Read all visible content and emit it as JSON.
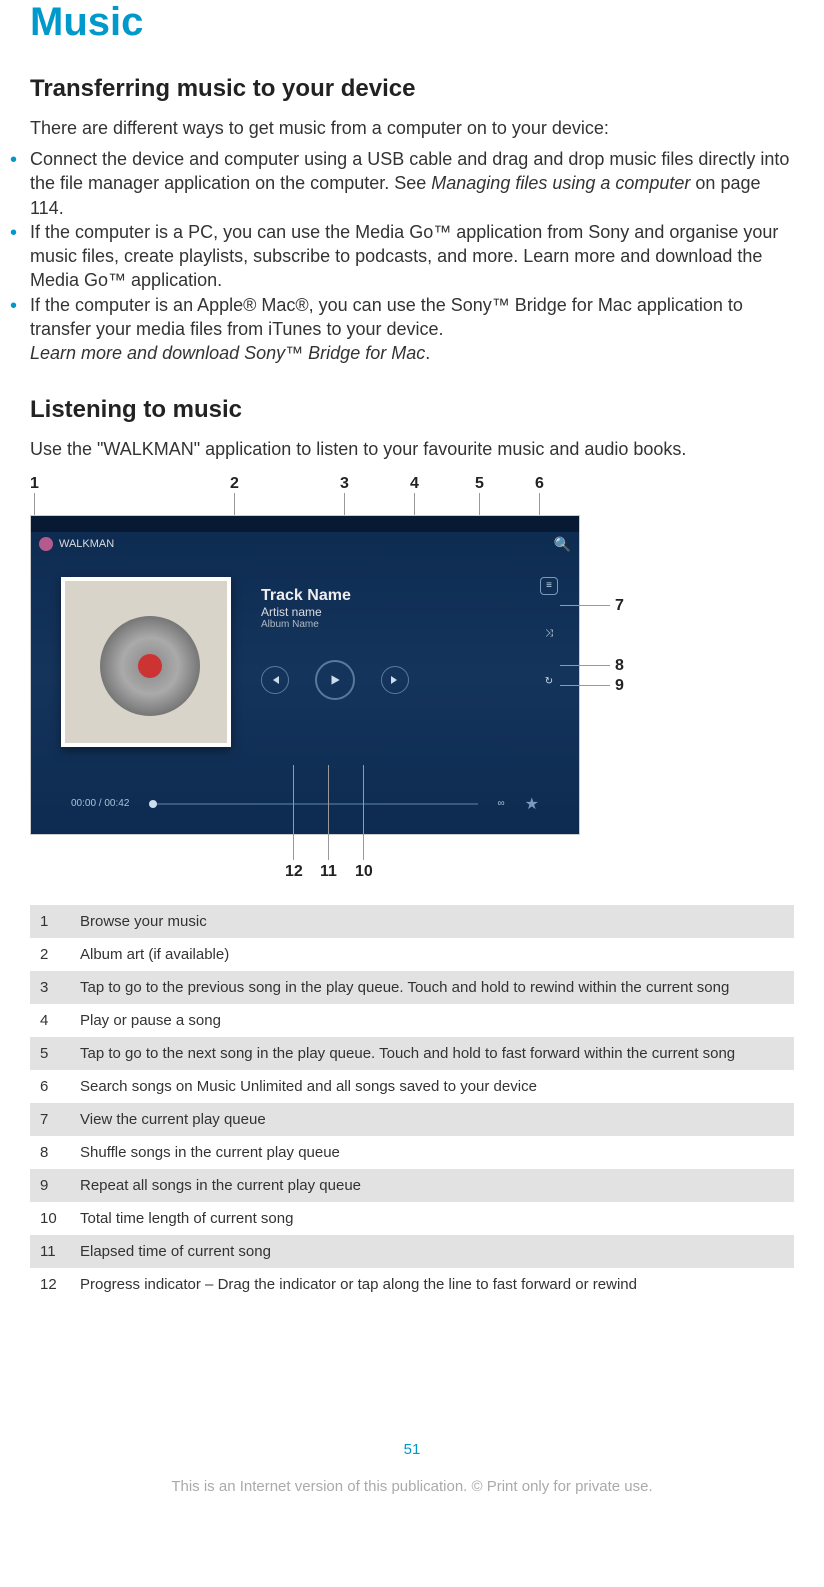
{
  "title": "Music",
  "section1": {
    "heading": "Transferring music to your device",
    "intro": "There are different ways to get music from a computer on to your device:",
    "bullets": [
      {
        "text_a": "Connect the device and computer using a USB cable and drag and drop music files directly into the file manager application on the computer. See ",
        "italic": "Managing files using a computer",
        "text_b": " on page 114."
      },
      {
        "text_a": "If the computer is a PC, you can use the Media Go™ application from Sony and organise your music files, create playlists, subscribe to podcasts, and more. Learn more and download the Media Go™ application.",
        "italic": "",
        "text_b": ""
      },
      {
        "text_a": "If the computer is an Apple® Mac®, you can use the Sony™ Bridge for Mac application to transfer your media files from iTunes to your device.",
        "italic": "Learn more and download Sony™ Bridge for Mac",
        "text_b": "."
      }
    ]
  },
  "section2": {
    "heading": "Listening to music",
    "intro": "Use the \"WALKMAN\" application to listen to your favourite music and audio books."
  },
  "walkman": {
    "app_label": "WALKMAN",
    "track": "Track Name",
    "artist": "Artist name",
    "album": "Album Name",
    "time": "00:00 / 00:42"
  },
  "callouts": {
    "c1": "1",
    "c2": "2",
    "c3": "3",
    "c4": "4",
    "c5": "5",
    "c6": "6",
    "c7": "7",
    "c8": "8",
    "c9": "9",
    "c10": "10",
    "c11": "11",
    "c12": "12"
  },
  "legend": [
    {
      "num": "1",
      "text": "Browse your music"
    },
    {
      "num": "2",
      "text": "Album art (if available)"
    },
    {
      "num": "3",
      "text": "Tap to go to the previous song in the play queue. Touch and hold to rewind within the current song"
    },
    {
      "num": "4",
      "text": "Play or pause a song"
    },
    {
      "num": "5",
      "text": "Tap to go to the next song in the play queue. Touch and hold to fast forward within the current song"
    },
    {
      "num": "6",
      "text": "Search songs on Music Unlimited and all songs saved to your device"
    },
    {
      "num": "7",
      "text": "View the current play queue"
    },
    {
      "num": "8",
      "text": "Shuffle songs in the current play queue"
    },
    {
      "num": "9",
      "text": "Repeat all songs in the current play queue"
    },
    {
      "num": "10",
      "text": "Total time length of current song"
    },
    {
      "num": "11",
      "text": "Elapsed time of current song"
    },
    {
      "num": "12",
      "text": "Progress indicator – Drag the indicator or tap along the line to fast forward or rewind"
    }
  ],
  "page_number": "51",
  "disclaimer": "This is an Internet version of this publication. © Print only for private use."
}
